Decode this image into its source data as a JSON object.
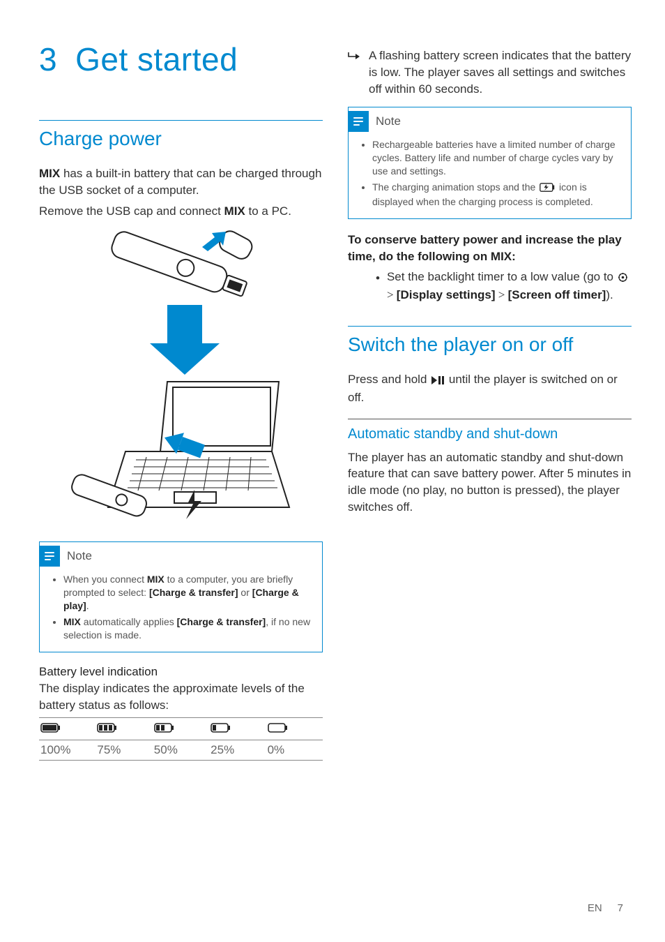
{
  "chapter": {
    "num": "3",
    "title": "Get started"
  },
  "s1": {
    "heading": "Charge power",
    "p1a": "MIX",
    "p1b": " has a built-in battery that can be charged through the USB socket of a computer.",
    "p2a": "Remove the USB cap and connect ",
    "p2b": "MIX",
    "p2c": " to a PC."
  },
  "note1": {
    "title": "Note",
    "i1a": "When you connect ",
    "i1b": "MIX",
    "i1c": " to a computer, you are briefly prompted to select: ",
    "i1d": "[Charge & transfer]",
    "i1e": " or ",
    "i1f": "[Charge & play]",
    "i1g": ".",
    "i2a": "MIX",
    "i2b": " automatically applies ",
    "i2c": "[Charge & transfer]",
    "i2d": ", if no new selection is made."
  },
  "batt_section": {
    "heading": "Battery level indication",
    "desc": "The display indicates the approximate levels of the battery status as follows:",
    "levels": [
      "100%",
      "75%",
      "50%",
      "25%",
      "0%"
    ]
  },
  "flash": {
    "text": "A flashing battery screen indicates that the battery is low. The player saves all settings and switches off within 60 seconds."
  },
  "note2": {
    "title": "Note",
    "i1": "Rechargeable batteries have a limited number of charge cycles. Battery life and number of charge cycles vary by use and settings.",
    "i2a": "The charging animation stops and the ",
    "i2b": " icon is displayed when the charging process is completed."
  },
  "conserve": {
    "intro": "To conserve battery power and increase the play time, do the following on MIX:",
    "b1a": "Set the backlight timer to a low value (go to ",
    "b1b": " > ",
    "b1c": "[Display settings]",
    "b1d": " > ",
    "b1e": "[Screen off timer]",
    "b1f": ")."
  },
  "s2": {
    "heading": "Switch the player on or off",
    "p1a": "Press and hold ",
    "p1b": " until the player is switched on or off."
  },
  "s3": {
    "heading": "Automatic standby and shut-down",
    "p": "The player has an automatic standby and shut-down feature that can save battery power. After 5 minutes in idle mode (no play, no button is pressed), the player switches off."
  },
  "footer": {
    "lang": "EN",
    "page": "7"
  }
}
